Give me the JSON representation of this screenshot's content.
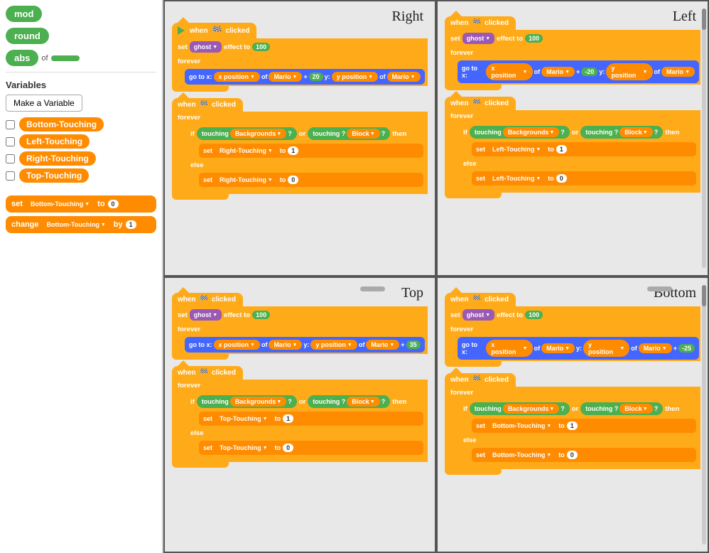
{
  "sidebar": {
    "blocks": {
      "mod_label": "mod",
      "round_label": "round",
      "abs_label": "abs",
      "of_label": "of"
    },
    "variables_title": "Variables",
    "make_variable_btn": "Make a Variable",
    "vars": [
      {
        "name": "Bottom-Touching"
      },
      {
        "name": "Left-Touching"
      },
      {
        "name": "Right-Touching"
      },
      {
        "name": "Top-Touching"
      }
    ],
    "set_block": {
      "label": "set",
      "var_name": "Bottom-Touching",
      "to_label": "to",
      "value": "0"
    },
    "change_block": {
      "label": "change",
      "var_name": "Bottom-Touching",
      "by_label": "by",
      "value": "1"
    }
  },
  "quadrants": {
    "right": {
      "label": "Right",
      "group1": {
        "hat": "when 🏁 clicked",
        "set_effect": "set ghost ▼ effect to 100",
        "forever": "forever",
        "goto": "go to x: x position ▼ of Mario ▼ + 20 y: y position ▼ of Mario ▼"
      },
      "group2": {
        "hat": "when 🏁 clicked",
        "forever": "forever",
        "if_row": "if touching Backgrounds ▼ ? or touching ? Block ▼ ? then",
        "set_true": "set Right-Touching ▼ to 1",
        "else": "else",
        "set_false": "set Right-Touching ▼ to 0"
      }
    },
    "left": {
      "label": "Left",
      "group1": {
        "hat": "when 🏁 clicked",
        "set_effect": "set ghost ▼ effect to 100",
        "forever": "forever",
        "goto": "go to x: x position ▼ of Mario ▼ + -20 y: y position ▼ of Mario ▼"
      },
      "group2": {
        "hat": "when 🏁 clicked",
        "forever": "forever",
        "if_row": "if touching Backgrounds ▼ ? or touching ? Block ▼ ? then",
        "set_true": "set Left-Touching ▼ to 1",
        "else": "else",
        "set_false": "set Left-Touching ▼ to 0"
      }
    },
    "top": {
      "label": "Top",
      "group1": {
        "hat": "when 🏁 clicked",
        "set_effect": "set ghost ▼ effect to 100",
        "forever": "forever",
        "goto": "go to x: x position ▼ of Mario ▼ y: y position ▼ of Mario ▼ + 35"
      },
      "group2": {
        "hat": "when 🏁 clicked",
        "forever": "forever",
        "if_row": "if touching Backgrounds ▼ ? or touching ? Block ▼ ? then",
        "set_true": "set Top-Touching ▼ to 1",
        "else": "else",
        "set_false": "set Top-Touching ▼ to 0"
      }
    },
    "bottom": {
      "label": "Bottom",
      "group1": {
        "hat": "when 🏁 clicked",
        "set_effect": "set ghost ▼ effect to 100",
        "forever": "forever",
        "goto": "go to x: x position ▼ of Mario ▼ y: y position ▼ of Mario ▼ + -25"
      },
      "group2": {
        "hat": "when 🏁 clicked",
        "forever": "forever",
        "if_row": "if touching Backgrounds ▼ ? or touching ? Block ▼ ? then",
        "set_true": "set Bottom-Touching ▼ to 1",
        "else": "else",
        "set_false": "set Bottom-Touching ▼ to 0"
      }
    }
  }
}
